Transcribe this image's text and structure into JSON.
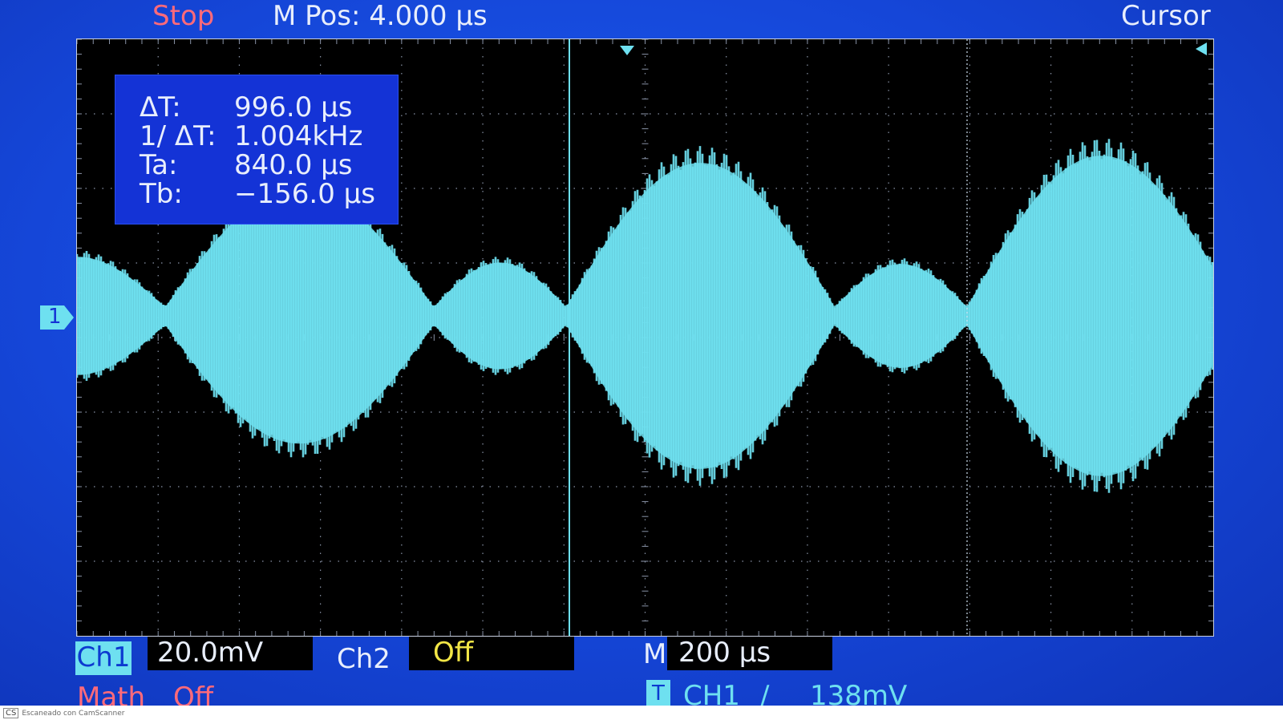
{
  "header": {
    "status": "Stop",
    "mpos_label": "M Pos: 4.000 µs",
    "mode": "Cursor"
  },
  "readout": {
    "rows": [
      {
        "key": "ΔT:",
        "value": "996.0 µs"
      },
      {
        "key": "1/ ΔT:",
        "value": "1.004kHz"
      },
      {
        "key": "Ta:",
        "value": "840.0 µs"
      },
      {
        "key": "Tb:",
        "value": "−156.0 µs"
      }
    ]
  },
  "channel_marker": "1",
  "bottom_bar": {
    "ch1_label": "Ch1",
    "ch1_scale": "20.0mV",
    "ch2_label": "Ch2",
    "ch2_state": "Off",
    "timebase_label": "M",
    "timebase_value": "200 µs",
    "math_label": "Math",
    "math_state": "Off",
    "trigger_icon": "T",
    "trigger_source": "CH1",
    "trigger_slope": "∕",
    "trigger_level": "138mV"
  },
  "watermark": {
    "logo": "CS",
    "text": "Escaneado con CamScanner"
  },
  "colors": {
    "waveform": "#6ee0f0",
    "cursor_line": "#6ee0f0",
    "background": "#1546d8",
    "grid_dots": "#8a94a8"
  },
  "icons": {
    "trigger_marker": "down-arrow-icon",
    "trigger_level_marker": "left-arrow-icon",
    "channel_marker": "right-pointer-icon"
  }
}
